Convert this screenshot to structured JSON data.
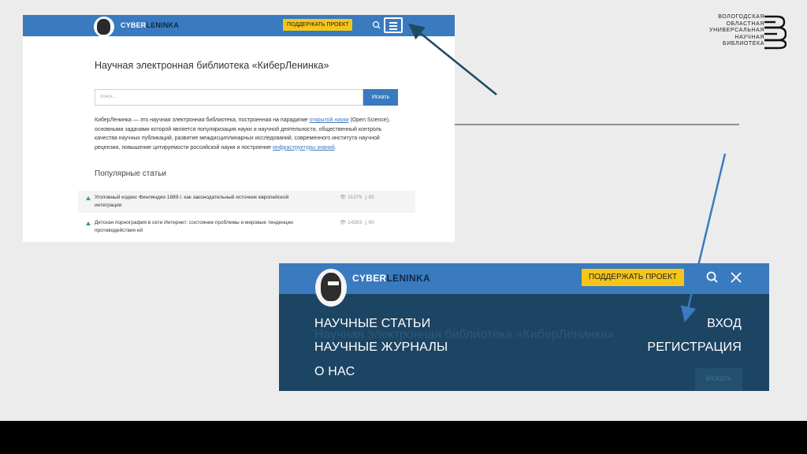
{
  "screenshot_desktop": {
    "header": {
      "brand_part1": "CYBER",
      "brand_part2": "LENINKA",
      "support_button": "ПОДДЕРЖАТЬ ПРОЕКТ",
      "search_icon": "search-icon",
      "menu_icon": "hamburger-menu-icon"
    },
    "title": "Научная электронная библиотека «КиберЛенинка»",
    "search": {
      "placeholder": "поиск...",
      "button": "Искать"
    },
    "description": {
      "part1": "КиберЛенинка — это научная электронная библиотека, построенная на парадигме ",
      "link1": "открытой науки",
      "part2": " (Open Science), основными задачами которой является популяризация науки и научной деятельности, общественный контроль качества научных публикаций, развитие междисциплинарных исследований, современного института научной рецензии, повышение цитируемости российской науки и построение ",
      "link2": "инфраструктуры знаний",
      "part3": "."
    },
    "popular_title": "Популярные статьи",
    "articles": [
      {
        "title": "Уголовный кодекс Финляндии 1889 г. как законодательный источник европейской интеграции",
        "views": "31379",
        "downloads": "85"
      },
      {
        "title": "Детская порнография в сети Интернет: состояние проблемы и мировые тенденции противодействия ей",
        "views": "14383",
        "downloads": "60"
      }
    ]
  },
  "library_logo": {
    "lines": [
      "ВОЛОГОДСКАЯ",
      "ОБЛАСТНАЯ",
      "УНИВЕРСАЛЬНАЯ",
      "НАУЧНАЯ",
      "БИБЛИОТЕКА"
    ]
  },
  "screenshot_mobile_menu": {
    "header": {
      "brand_part1": "CYBER",
      "brand_part2": "LENINKA",
      "support_button": "ПОДДЕРЖАТЬ ПРОЕКТ",
      "search_icon": "search-icon",
      "close_icon": "close-icon"
    },
    "background_title": "Научная электронная библиотека «КиберЛенинка»",
    "background_button": "Искать",
    "nav_left": [
      "НАУЧНЫЕ СТАТЬИ",
      "НАУЧНЫЕ ЖУРНАЛЫ",
      "О НАС"
    ],
    "nav_right": [
      "ВХОД",
      "РЕГИСТРАЦИЯ"
    ]
  },
  "colors": {
    "header_blue": "#3a7abf",
    "menu_dark": "#1c4563",
    "support_yellow": "#f5c518",
    "arrow_dark": "#1f4a63",
    "arrow_blue": "#3a7abf"
  }
}
